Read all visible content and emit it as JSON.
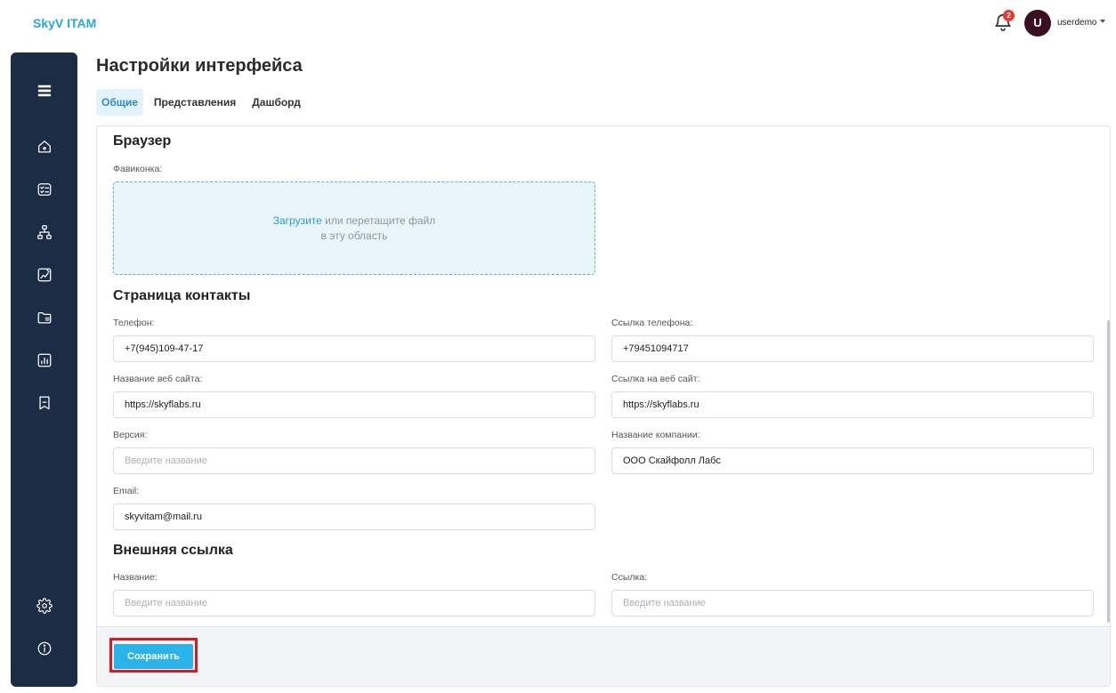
{
  "app": {
    "title": "SkyV ITAM"
  },
  "header": {
    "notifications_count": "2",
    "avatar_letter": "U",
    "username": "userdemo"
  },
  "sidebar": {
    "items": [
      {
        "icon": "menu-icon"
      },
      {
        "icon": "home-icon"
      },
      {
        "icon": "checklist-icon"
      },
      {
        "icon": "hierarchy-icon"
      },
      {
        "icon": "chart-edit-icon"
      },
      {
        "icon": "folder-list-icon"
      },
      {
        "icon": "bar-chart-icon"
      },
      {
        "icon": "bookmark-icon"
      },
      {
        "icon": "settings-icon"
      },
      {
        "icon": "info-icon"
      }
    ]
  },
  "page": {
    "title": "Настройки интерфейса"
  },
  "tabs": [
    {
      "label": "Общие",
      "active": true
    },
    {
      "label": "Представления",
      "active": false
    },
    {
      "label": "Дашборд",
      "active": false
    }
  ],
  "browser": {
    "heading": "Браузер",
    "favicon_label": "Фавиконка:",
    "upload_link": "Загрузите",
    "upload_text_1": " или перетащите файл",
    "upload_text_2": "в эту область"
  },
  "contacts": {
    "heading": "Страница контакты",
    "phone_label": "Телефон:",
    "phone_value": "+7(945)109-47-17",
    "phone_link_label": "Ссылка телефона:",
    "phone_link_value": "+79451094717",
    "site_name_label": "Название веб сайта:",
    "site_name_value": "https://skyflabs.ru",
    "site_link_label": "Ссылка на веб сайт:",
    "site_link_value": "https://skyflabs.ru",
    "version_label": "Версия:",
    "version_placeholder": "Введите название",
    "company_label": "Название компании:",
    "company_value": "ООО Скайфолл Лабс",
    "email_label": "Email:",
    "email_value": "skyvitam@mail.ru"
  },
  "external": {
    "heading": "Внешняя ссылка",
    "name_label": "Название:",
    "name_placeholder": "Введите название",
    "link_label": "Ссылка:",
    "link_placeholder": "Введите название"
  },
  "footer": {
    "save_label": "Сохранить"
  },
  "colors": {
    "accent": "#2ab3e8",
    "sidebar": "#1b2c44",
    "highlight": "#e3161f"
  }
}
